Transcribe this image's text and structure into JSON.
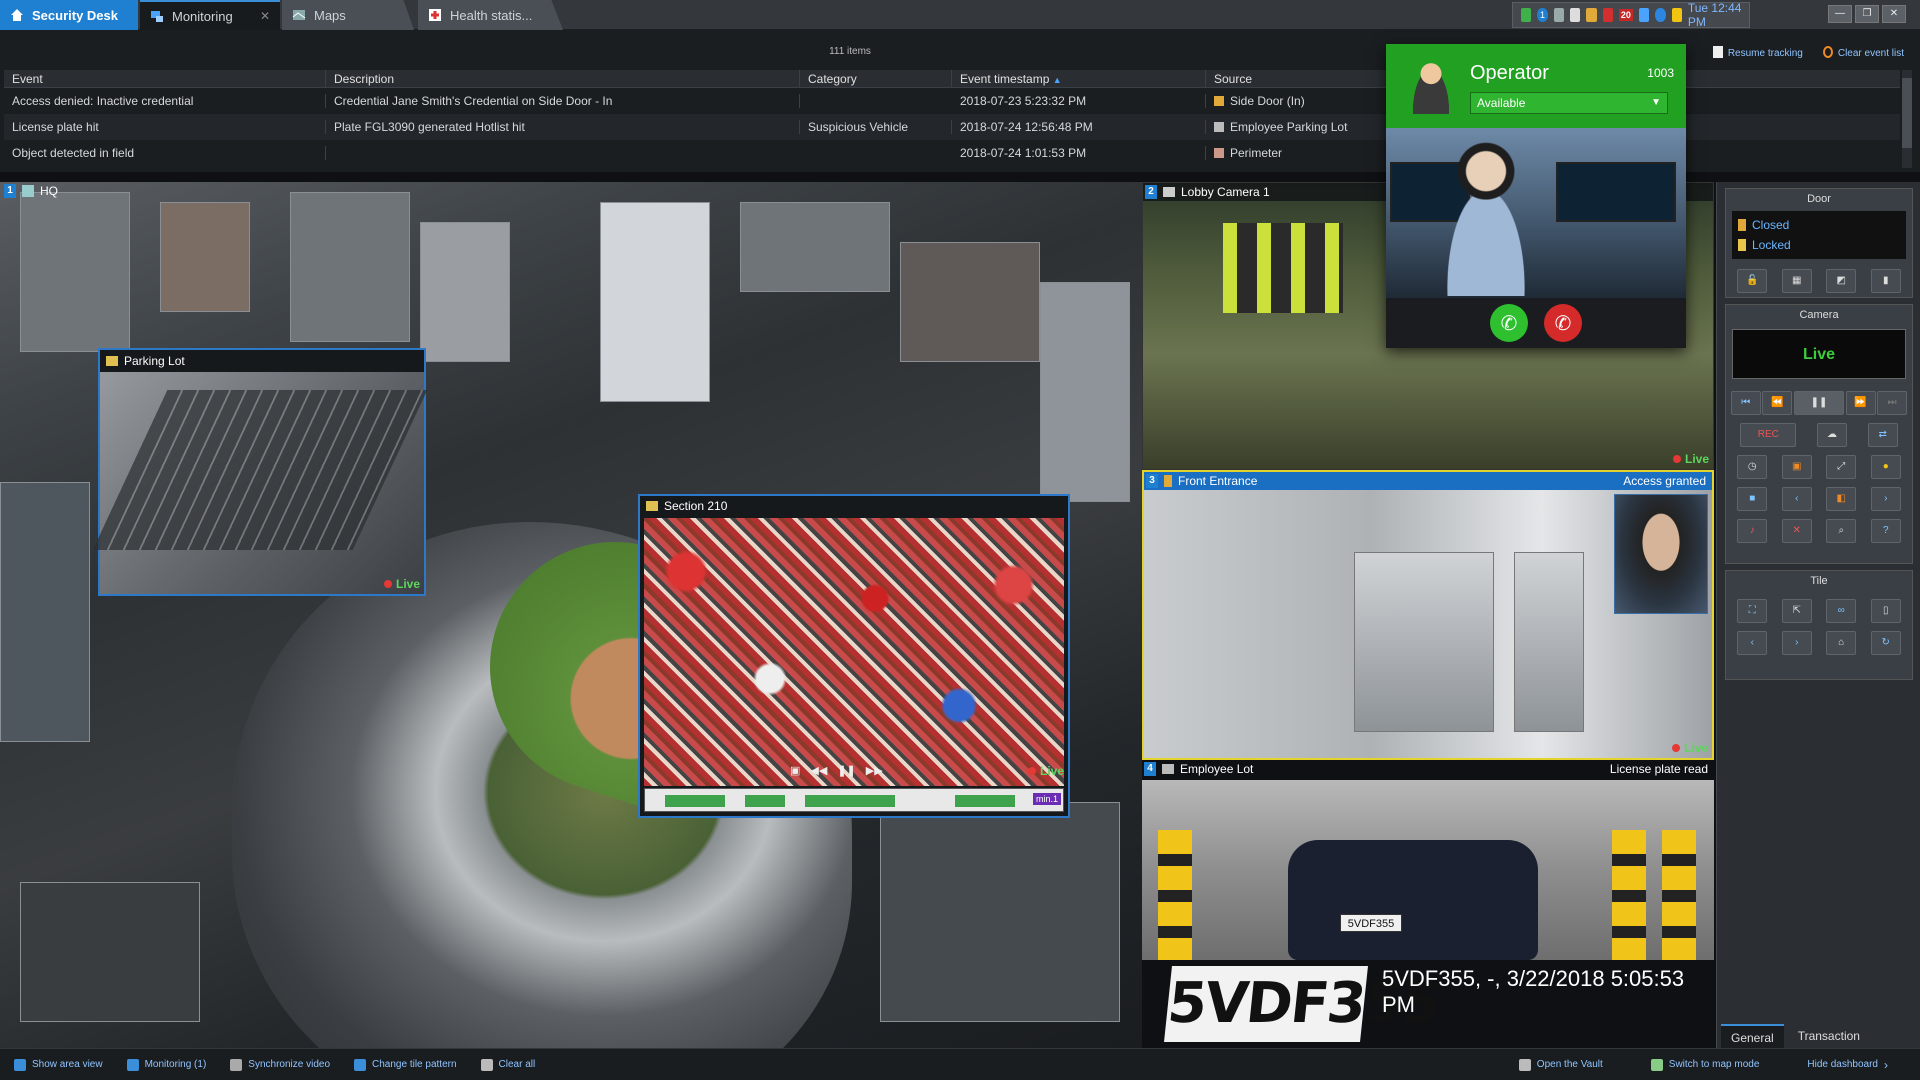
{
  "tabs": {
    "security_desk": "Security Desk",
    "monitoring": "Monitoring",
    "maps": "Maps",
    "health": "Health statis..."
  },
  "tray": {
    "alert_count": "20",
    "clock": "Tue 12:44 PM",
    "badge": "1"
  },
  "events": {
    "count": "111 items",
    "resume_tracking": "Resume tracking",
    "clear_list": "Clear event list",
    "columns": [
      "Event",
      "Description",
      "Category",
      "Event timestamp",
      "Source"
    ],
    "rows": [
      {
        "event": "Access denied: Inactive credential",
        "description": "Credential Jane Smith's Credential on Side Door - In",
        "category": "",
        "timestamp": "2018-07-23 5:23:32 PM",
        "source": "Side Door (In)"
      },
      {
        "event": "License plate hit",
        "description": "Plate FGL3090 generated Hotlist hit",
        "category": "Suspicious Vehicle",
        "timestamp": "2018-07-24 12:56:48 PM",
        "source": "Employee Parking Lot"
      },
      {
        "event": "Object detected in field",
        "description": "",
        "category": "",
        "timestamp": "2018-07-24 1:01:53 PM",
        "source": "Perimeter"
      }
    ]
  },
  "tiles": {
    "t1": {
      "num": "1",
      "name": "HQ"
    },
    "parking": {
      "name": "Parking Lot",
      "live": "Live"
    },
    "section": {
      "name": "Section 210",
      "live": "Live",
      "tl_label": "min.1"
    },
    "t2": {
      "num": "2",
      "name": "Lobby Camera 1",
      "live": "Live"
    },
    "t3": {
      "num": "3",
      "name": "Front Entrance",
      "status": "Access granted",
      "live": "Live"
    },
    "t4": {
      "num": "4",
      "name": "Employee Lot",
      "lpr": "License plate read",
      "plate": "5VDF355",
      "plate_small": "5VDF355",
      "read": "5VDF355, -, 3/22/2018 5:05:53 PM"
    }
  },
  "operator": {
    "name": "Operator",
    "ext": "1003",
    "status": "Available"
  },
  "dashboard": {
    "door_title": "Door",
    "door_closed": "Closed",
    "door_locked": "Locked",
    "camera_title": "Camera",
    "camera_live": "Live",
    "rec": "REC",
    "tile_title": "Tile",
    "tab_general": "General",
    "tab_transaction": "Transaction"
  },
  "bottombar": {
    "show_area": "Show area view",
    "monitoring": "Monitoring (1)",
    "sync": "Synchronize video",
    "tile_pattern": "Change tile pattern",
    "clear_all": "Clear all",
    "open_vault": "Open the Vault",
    "switch_map": "Switch to map mode",
    "hide_dash": "Hide dashboard"
  },
  "colors": {
    "accent": "#1f7fd0",
    "live": "#5cd65c",
    "operator": "#22a022",
    "granted_border": "#e3d32a"
  }
}
